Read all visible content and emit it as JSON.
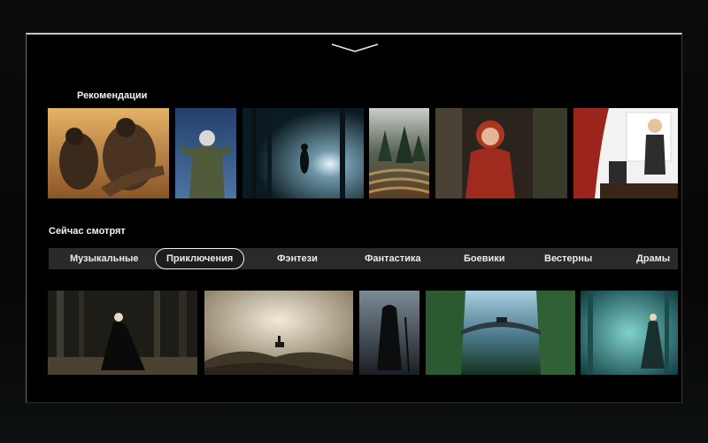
{
  "recommendations": {
    "title": "Рекомендации",
    "tiles": [
      {
        "name": "desert-warriors",
        "colors": [
          "#d79a4c",
          "#8a5a2a"
        ]
      },
      {
        "name": "astronaut",
        "colors": [
          "#3e5f8a",
          "#1b2c45"
        ]
      },
      {
        "name": "foggy-forest-light",
        "colors": [
          "#2f4c57",
          "#0e1c22"
        ]
      },
      {
        "name": "hedge-maze",
        "colors": [
          "#6f7b6f",
          "#3c2e1e"
        ]
      },
      {
        "name": "red-hood-girl",
        "colors": [
          "#4a4034",
          "#1e1a14"
        ]
      },
      {
        "name": "girl-theater-curtain",
        "colors": [
          "#a12a22",
          "#e9e9e9"
        ]
      }
    ]
  },
  "now_watching": {
    "title": "Сейчас смотрят",
    "genres": [
      {
        "label": "Музыкальные",
        "active": false
      },
      {
        "label": "Приключения",
        "active": true
      },
      {
        "label": "Фэнтези",
        "active": false
      },
      {
        "label": "Фантастика",
        "active": false
      },
      {
        "label": "Боевики",
        "active": false
      },
      {
        "label": "Вестерны",
        "active": false
      },
      {
        "label": "Драмы",
        "active": false
      }
    ],
    "tiles": [
      {
        "name": "dark-forest-woman",
        "colors": [
          "#3a3a30",
          "#14140f"
        ]
      },
      {
        "name": "rider-on-hills",
        "colors": [
          "#cfc3a3",
          "#5c5240"
        ]
      },
      {
        "name": "cloaked-figure",
        "colors": [
          "#5a6670",
          "#1a1f24"
        ]
      },
      {
        "name": "bridge-canyon",
        "colors": [
          "#5d8aa0",
          "#1f3d2a"
        ]
      },
      {
        "name": "teal-forest-girl",
        "colors": [
          "#3fa7a5",
          "#0f3a3c"
        ]
      }
    ]
  },
  "icons": {
    "collapse": "chevron-down-icon"
  }
}
